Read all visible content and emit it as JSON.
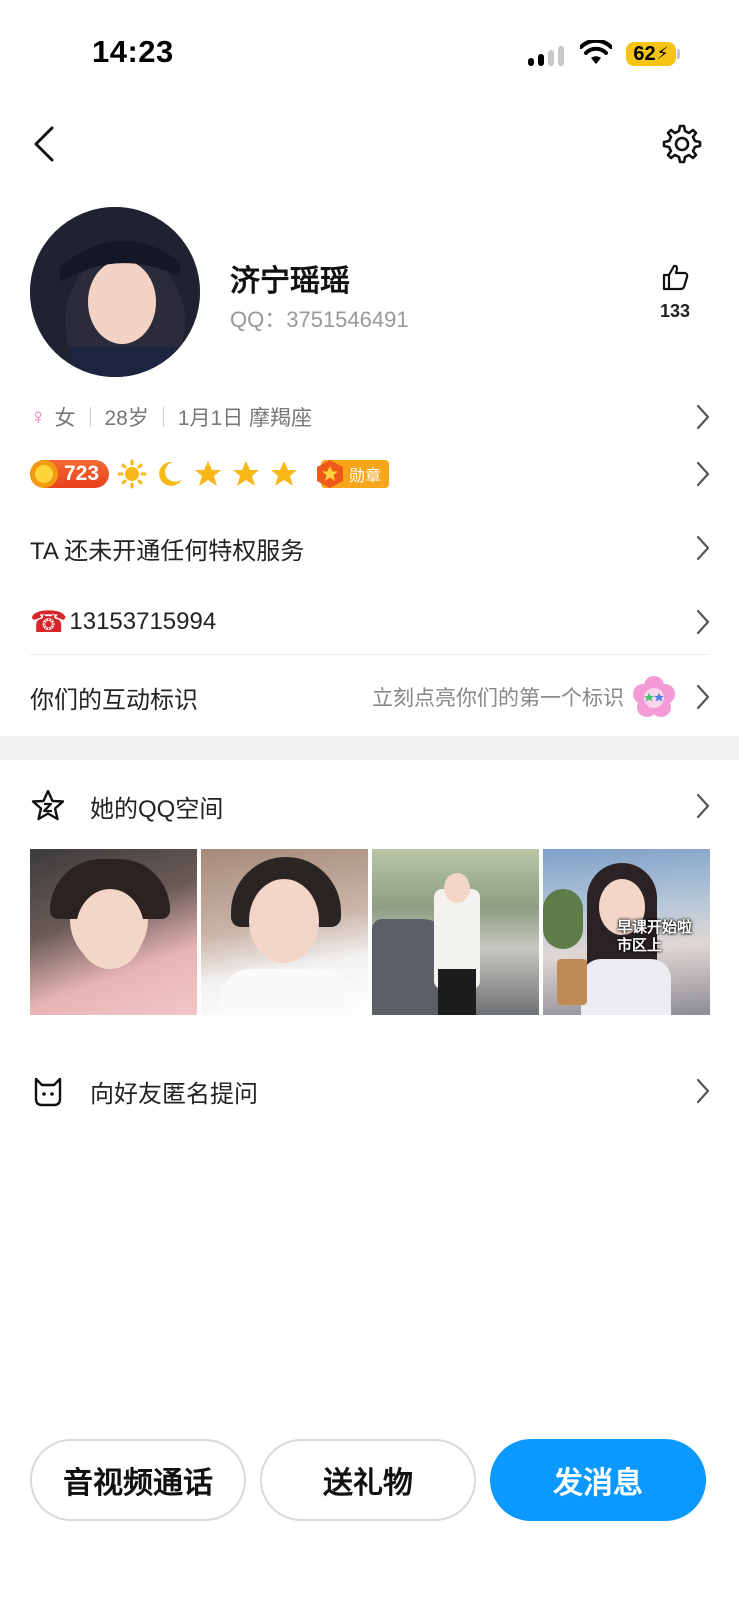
{
  "status_bar": {
    "time": "14:23",
    "battery": "62"
  },
  "header": {
    "back_icon": "chevron-left-icon",
    "settings_icon": "gear-icon"
  },
  "profile": {
    "nickname": "济宁瑶瑶",
    "qq_label": "QQ：",
    "qq_number": "3751546491",
    "like_count": "133"
  },
  "info": {
    "gender_symbol": "♀",
    "gender": "女",
    "age": "28岁",
    "birthday": "1月1日 摩羯座"
  },
  "level": {
    "value": "723",
    "medal_label": "勋章",
    "icons": [
      "sun-icon",
      "moon-icon",
      "star-icon",
      "star-icon",
      "star-icon"
    ]
  },
  "privilege": {
    "label": "TA 还未开通任何特权服务"
  },
  "phone": {
    "icon": "☎",
    "number": "13153715994"
  },
  "interaction": {
    "label": "你们的互动标识",
    "hint": "立刻点亮你们的第一个标识"
  },
  "qzone": {
    "label": "她的QQ空间",
    "photo_caption": [
      "早课开始啦",
      "市区上"
    ]
  },
  "anonymous": {
    "label": "向好友匿名提问"
  },
  "actions": {
    "call": "音视频通话",
    "gift": "送礼物",
    "message": "发消息"
  },
  "colors": {
    "accent": "#0b99ff",
    "battery": "#f6c513",
    "level_badge": "#ea3f1d",
    "medal": "#f7a51a",
    "gender": "#e96bb3"
  }
}
